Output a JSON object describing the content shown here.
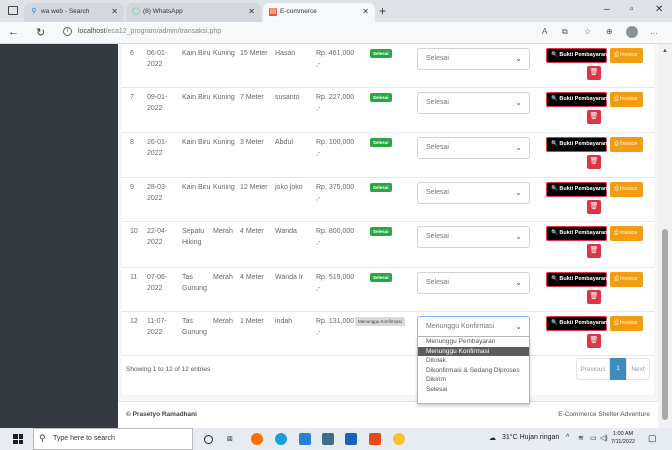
{
  "browser": {
    "tabs": [
      {
        "title": "wa web - Search",
        "icon": "search-icon"
      },
      {
        "title": "(8) WhatsApp",
        "icon": "whatsapp-icon"
      },
      {
        "title": "E-commerce",
        "icon": "site-icon"
      }
    ],
    "url_host": "localhost",
    "url_path": "/eca12_program/admin/transaksi.php"
  },
  "table": {
    "rows": [
      {
        "no": "6",
        "date": "06-01-2022",
        "product": "Kain Biru",
        "color": "Kuning",
        "size": "15 Meter",
        "name": "Hasan",
        "price": "Rp. 461,000 ,-",
        "badge": "Selesai",
        "status": "Selesai",
        "open": false
      },
      {
        "no": "7",
        "date": "09-01-2022",
        "product": "Kain Biru",
        "color": "Kuning",
        "size": "7 Meter",
        "name": "susanto",
        "price": "Rp. 227,000 ,-",
        "badge": "Selesai",
        "status": "Selesai",
        "open": false
      },
      {
        "no": "8",
        "date": "26-01-2022",
        "product": "Kain Biru",
        "color": "Kuning",
        "size": "3 Meter",
        "name": "Abdul",
        "price": "Rp. 100,000 ,-",
        "badge": "Selesai",
        "status": "Selesai",
        "open": false
      },
      {
        "no": "9",
        "date": "28-03-2022",
        "product": "Kain Biru",
        "color": "Kuning",
        "size": "12 Meter",
        "name": "joko joko",
        "price": "Rp. 375,000 ,-",
        "badge": "Selesai",
        "status": "Selesai",
        "open": false
      },
      {
        "no": "10",
        "date": "22-04-2022",
        "product": "Sepatu Hiking",
        "color": "Merah",
        "size": "4 Meter",
        "name": "Wanda",
        "price": "Rp. 800,000 ,-",
        "badge": "Selesai",
        "status": "Selesai",
        "open": false
      },
      {
        "no": "11",
        "date": "07-06-2022",
        "product": "Tas Gunung",
        "color": "Merah",
        "size": "4 Meter",
        "name": "Wanda Ir",
        "price": "Rp. 519,000 ,-",
        "badge": "Selesai",
        "status": "Selesai",
        "open": false
      },
      {
        "no": "12",
        "date": "11-07-2022",
        "product": "Tas Gunung",
        "color": "Merah",
        "size": "1 Meter",
        "name": "indah",
        "price": "Rp. 131,000 ,-",
        "badge": "Menunggu Konfirmasi",
        "status": "Menunggu Konfirmasi",
        "open": true
      }
    ],
    "bukti_label": "Bukti Pembayaran",
    "invoice_label": "Invoice",
    "delete_glyph": "🗑",
    "status_options": [
      "Menunggu Pembayaran",
      "Menunggu Konfirmasi",
      "Ditolak",
      "Dikonfirmasi & Sedang Diproses",
      "Dikirim",
      "Selesai"
    ],
    "selected_option": "Menunggu Konfirmasi",
    "showing": "Showing 1 to 12 of 12 entries",
    "pagination": {
      "prev": "Previous",
      "page": "1",
      "next": "Next"
    }
  },
  "footer": {
    "left": "© Prasetyo Ramadhani",
    "right": "E-Commerce Shelter Adventure"
  },
  "taskbar": {
    "search_placeholder": "Type here to search",
    "weather": "31°C  Hujan ringan",
    "time": "1:00 AM",
    "date": "7/11/2022"
  },
  "colors": {
    "sidebar": "#343a40",
    "success": "#28a745",
    "danger": "#dc3545",
    "warning": "#f39c12",
    "primary": "#3c8dbc"
  }
}
